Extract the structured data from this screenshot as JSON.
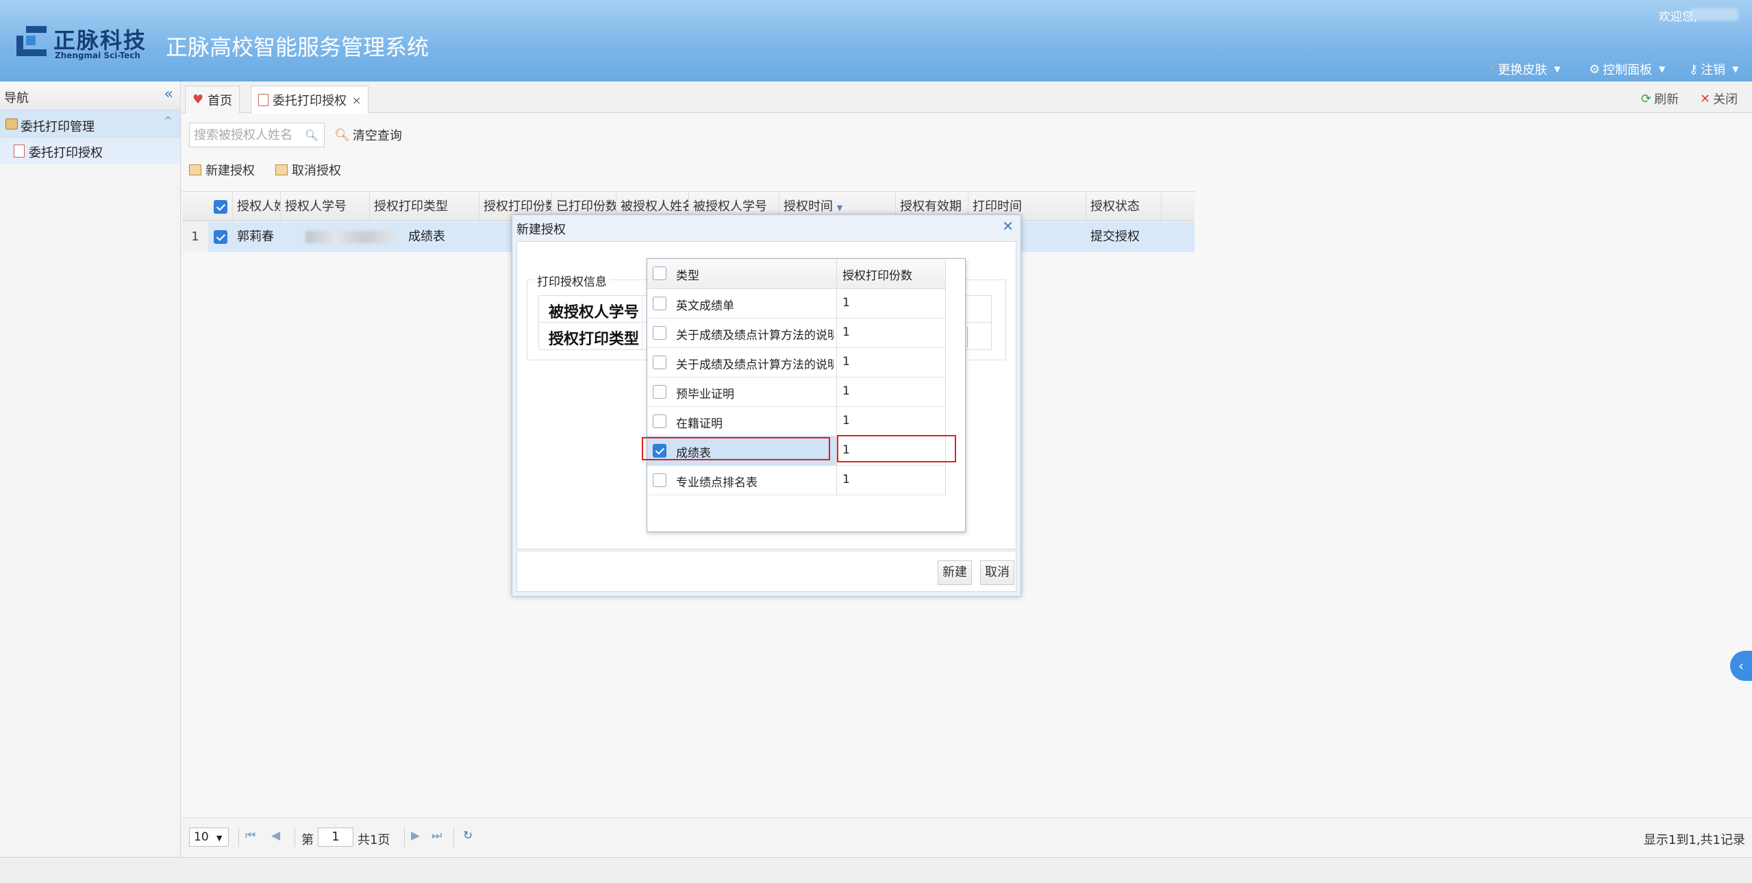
{
  "header": {
    "logo_cn": "正脉科技",
    "logo_en": "Zhengmai Sci-Tech",
    "app_title": "正脉高校智能服务管理系统",
    "welcome": "欢迎您,",
    "menu": {
      "skin": "更换皮肤",
      "control": "控制面板",
      "logout": "注销"
    }
  },
  "sidebar": {
    "title": "导航",
    "group": "委托打印管理",
    "item": "委托打印授权"
  },
  "tabs": {
    "home": "首页",
    "active": "委托打印授权",
    "refresh": "刷新",
    "close": "关闭"
  },
  "toolbar": {
    "search_placeholder": "搜索被授权人姓名",
    "clear": "清空查询",
    "new_auth": "新建授权",
    "cancel_auth": "取消授权"
  },
  "grid": {
    "headers": [
      "授权人姓名",
      "授权人学号",
      "授权打印类型",
      "授权打印份数",
      "已打印份数",
      "被授权人姓名",
      "被授权人学号",
      "授权时间",
      "授权有效期",
      "打印时间",
      "授权状态"
    ],
    "sort_indicator": "▼",
    "rows": [
      {
        "num": "1",
        "name": "郭莉春",
        "type": "成绩表",
        "status": "提交授权"
      }
    ]
  },
  "pager": {
    "page_size": "10",
    "page_prefix": "第",
    "page_value": "1",
    "page_suffix": "共1页",
    "info": "显示1到1,共1记录"
  },
  "dialog": {
    "title": "新建授权",
    "legend": "打印授权信息",
    "field_student_id": "被授权人学号",
    "field_print_type": "授权打印类型",
    "btn_new": "新建",
    "btn_cancel": "取消"
  },
  "dropdown": {
    "col_type": "类型",
    "col_copies": "授权打印份数",
    "rows": [
      {
        "label": "英文成绩单",
        "copies": "1",
        "checked": false
      },
      {
        "label": "关于成绩及绩点计算方法的说明",
        "copies": "1",
        "checked": false
      },
      {
        "label": "关于成绩及绩点计算方法的说明",
        "copies": "1",
        "checked": false
      },
      {
        "label": "预毕业证明",
        "copies": "1",
        "checked": false
      },
      {
        "label": "在籍证明",
        "copies": "1",
        "checked": false
      },
      {
        "label": "成绩表",
        "copies": "1",
        "checked": true
      },
      {
        "label": "专业绩点排名表",
        "copies": "1",
        "checked": false
      }
    ]
  },
  "colors": {
    "header_top": "#a5cff2",
    "header_bottom": "#6aaae4",
    "accent": "#2f7fd8",
    "highlight": "#e02020"
  }
}
